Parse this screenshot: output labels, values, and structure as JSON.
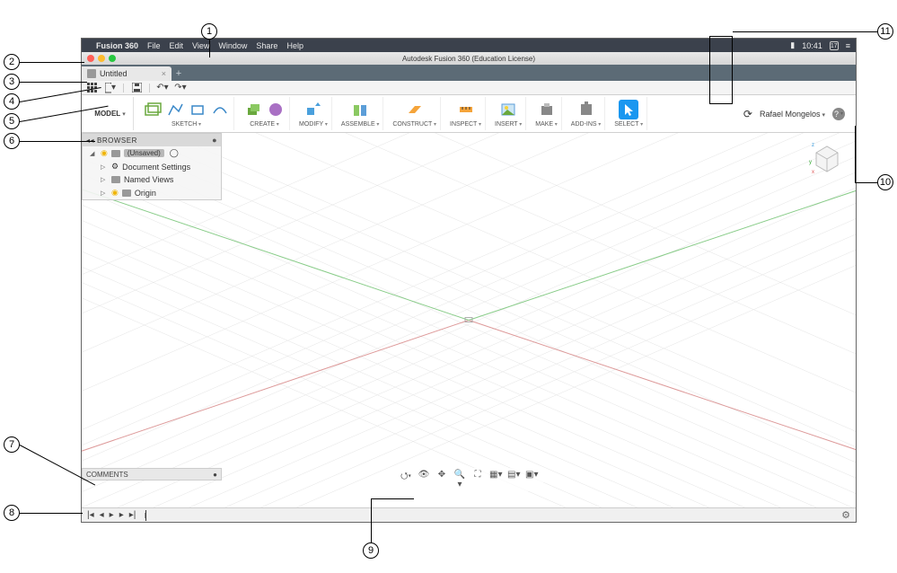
{
  "mac_menu": {
    "apple": "",
    "app_name": "Fusion 360",
    "items": [
      "File",
      "Edit",
      "View",
      "Window",
      "Share",
      "Help"
    ],
    "clock": "10:41",
    "battery_icon": "battery",
    "search_icon": "search",
    "notif_icon": "menu",
    "date_icon": "17"
  },
  "titlebar": {
    "title": "Autodesk Fusion 360 (Education License)"
  },
  "tabs": {
    "items": [
      {
        "label": "Untitled",
        "closeable": true
      }
    ],
    "add_label": "+"
  },
  "quickbar": {
    "data_panel_icon": "grid",
    "file_icon": "file",
    "save_icon": "save",
    "undo_icon": "undo",
    "redo_icon": "redo"
  },
  "ribbon": {
    "workspace": "MODEL",
    "groups": [
      {
        "key": "sketch",
        "label": "SKETCH",
        "icons": [
          "sketch-box",
          "line",
          "spline",
          "arc"
        ]
      },
      {
        "key": "create",
        "label": "CREATE",
        "icons": [
          "extrude",
          "primitive"
        ]
      },
      {
        "key": "modify",
        "label": "MODIFY",
        "icons": [
          "pressPull"
        ]
      },
      {
        "key": "assemble",
        "label": "ASSEMBLE",
        "icons": [
          "joint"
        ]
      },
      {
        "key": "construct",
        "label": "CONSTRUCT",
        "icons": [
          "plane"
        ]
      },
      {
        "key": "inspect",
        "label": "INSPECT",
        "icons": [
          "measure"
        ]
      },
      {
        "key": "insert",
        "label": "INSERT",
        "icons": [
          "image"
        ]
      },
      {
        "key": "make",
        "label": "MAKE",
        "icons": [
          "print"
        ]
      },
      {
        "key": "addins",
        "label": "ADD-INS",
        "icons": [
          "addins"
        ]
      },
      {
        "key": "select",
        "label": "SELECT",
        "icons": [
          "cursor"
        ],
        "selected": true
      }
    ],
    "user_name": "Rafael Mongelos",
    "help_label": "?"
  },
  "browser": {
    "header": "BROWSER",
    "root_tag": "(Unsaved)",
    "items": [
      {
        "label": "Document Settings",
        "icon": "gear"
      },
      {
        "label": "Named Views",
        "icon": "folder"
      },
      {
        "label": "Origin",
        "icon": "folder",
        "bulb": true
      }
    ]
  },
  "viewcube": {
    "axes": [
      "x",
      "y",
      "z"
    ]
  },
  "comments": {
    "label": "COMMENTS"
  },
  "navbar": {
    "tools": [
      "orbit",
      "look",
      "pan",
      "zoom",
      "fit",
      "display",
      "grid",
      "viewports"
    ]
  },
  "timeline": {
    "controls": [
      "first",
      "prev",
      "play",
      "next",
      "last"
    ],
    "gear": "⚙"
  },
  "callouts": {
    "1": "1",
    "2": "2",
    "3": "3",
    "4": "4",
    "5": "5",
    "6": "6",
    "7": "7",
    "8": "8",
    "9": "9",
    "10": "10",
    "11": "11"
  }
}
